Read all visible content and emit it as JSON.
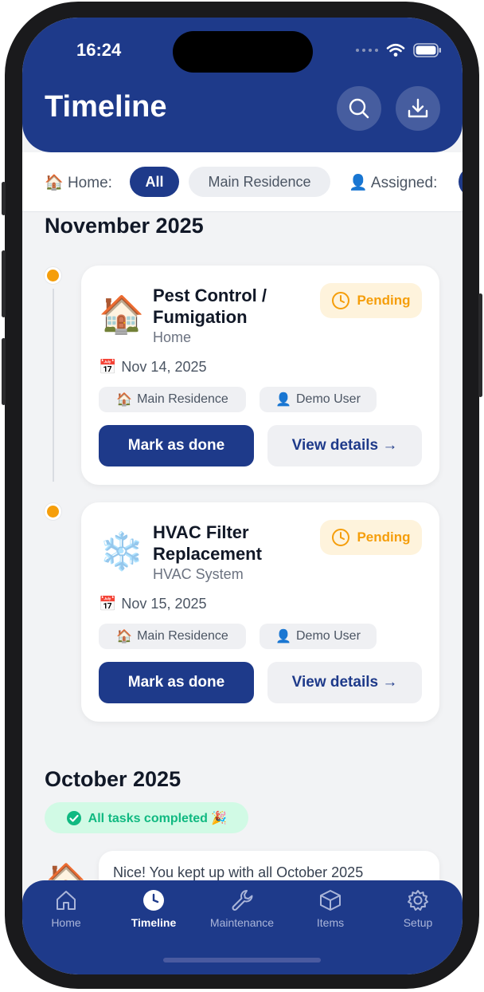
{
  "status": {
    "time": "16:24"
  },
  "header": {
    "title": "Timeline"
  },
  "filters": {
    "home_label": "Home:",
    "home_icon": "🏠",
    "chips": [
      "All",
      "Main Residence"
    ],
    "assigned_label": "Assigned:",
    "assigned_icon": "👤"
  },
  "sections": [
    {
      "month": "November 2025",
      "tasks": [
        {
          "emoji": "🏠",
          "title": "Pest Control / Fumigation",
          "subtitle": "Home",
          "status": "Pending",
          "date": "Nov 14, 2025",
          "residence": "Main Residence",
          "user": "Demo User",
          "primary": "Mark as done",
          "secondary": "View details →"
        },
        {
          "emoji": "❄️",
          "title": "HVAC Filter Replacement",
          "subtitle": "HVAC System",
          "status": "Pending",
          "date": "Nov 15, 2025",
          "residence": "Main Residence",
          "user": "Demo User",
          "primary": "Mark as done",
          "secondary": "View details →"
        }
      ]
    },
    {
      "month": "October 2025",
      "badge": "All tasks completed 🎉",
      "message": "Nice! You kept up with all October 2025",
      "emoji": "🏠"
    }
  ],
  "date_icon": "📅",
  "tabs": [
    {
      "label": "Home",
      "icon": "house-icon"
    },
    {
      "label": "Timeline",
      "icon": "clock-icon"
    },
    {
      "label": "Maintenance",
      "icon": "wrench-icon"
    },
    {
      "label": "Items",
      "icon": "box-icon"
    },
    {
      "label": "Setup",
      "icon": "gear-icon"
    }
  ],
  "colors": {
    "primary": "#1e3a8a",
    "pending": "#f59e0b",
    "success": "#10b981",
    "background": "#f2f3f5"
  }
}
